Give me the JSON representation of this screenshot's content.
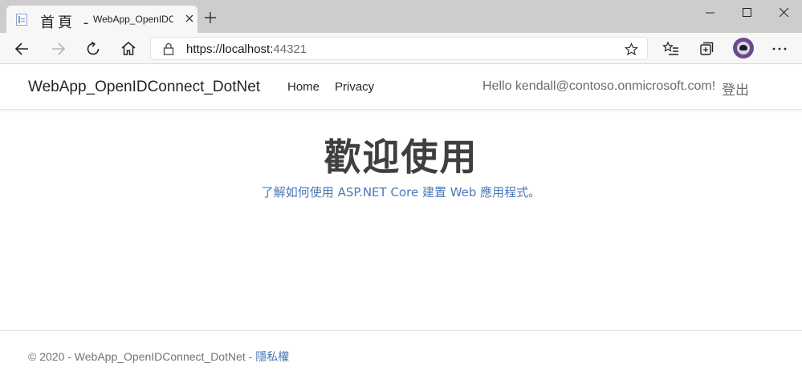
{
  "browser": {
    "tab": {
      "cjk_title": "首頁 -",
      "title": "WebApp_OpenIDC"
    },
    "address": {
      "url_main": "https://localhost:",
      "url_port": "44321"
    }
  },
  "page": {
    "navbar": {
      "brand": "WebApp_OpenIDConnect_DotNet",
      "links": [
        "Home",
        "Privacy"
      ],
      "hello": "Hello  kendall@contoso.onmicrosoft.com!",
      "signout": "登出"
    },
    "main": {
      "welcome": "歡迎使用",
      "learn": "了解如何使用 ASP.NET  Core 建置 Web 應用程式。"
    },
    "footer": {
      "copyright": "© 2020 - WebApp_OpenIDConnect_DotNet - ",
      "privacy": "隱私權"
    }
  },
  "colors": {
    "tabbar": "#cdcdcd",
    "toolbar": "#f7f7f7",
    "link": "#4a78b6",
    "heading": "#3f3f3f"
  }
}
